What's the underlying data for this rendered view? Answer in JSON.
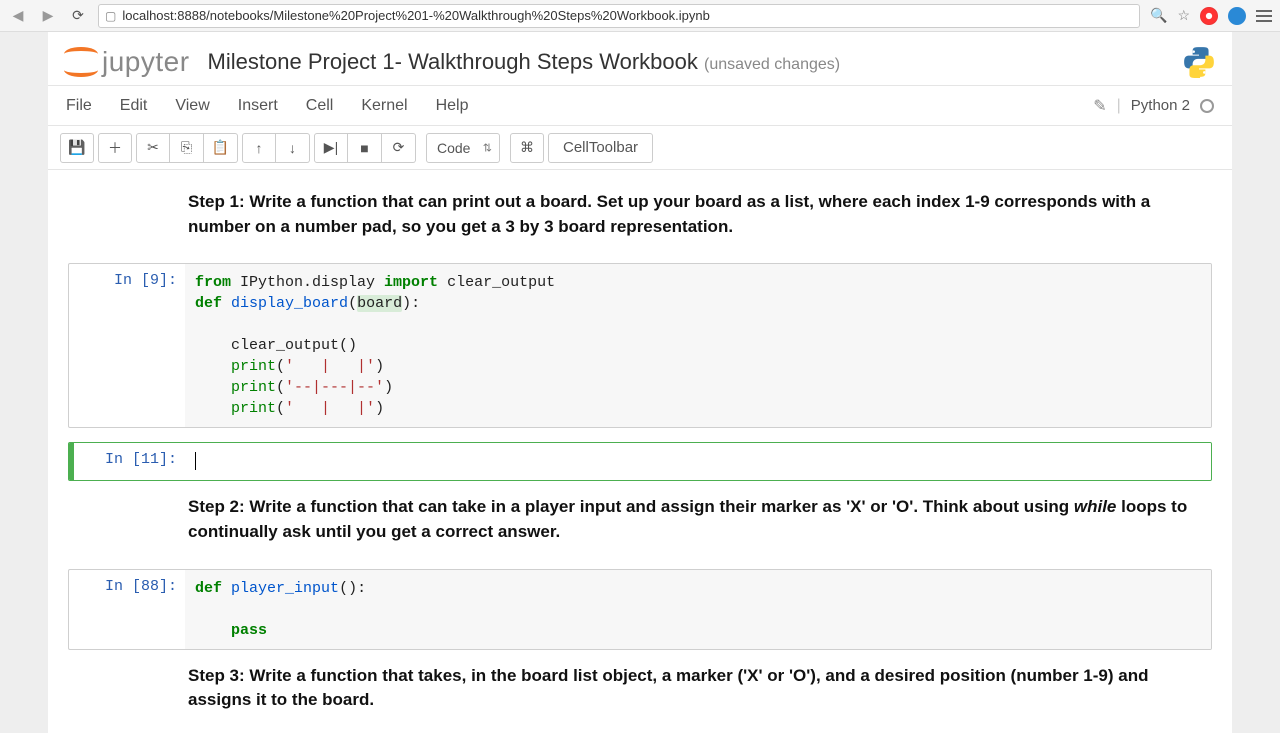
{
  "browser": {
    "url": "localhost:8888/notebooks/Milestone%20Project%201-%20Walkthrough%20Steps%20Workbook.ipynb"
  },
  "header": {
    "logo_text": "jupyter",
    "title": "Milestone Project 1- Walkthrough Steps Workbook",
    "status": "(unsaved changes)"
  },
  "menubar": {
    "items": [
      "File",
      "Edit",
      "View",
      "Insert",
      "Cell",
      "Kernel",
      "Help"
    ],
    "kernel": "Python 2"
  },
  "toolbar": {
    "cell_type": "Code",
    "celltoolbar": "CellToolbar"
  },
  "cells": {
    "step1_text": "Step 1: Write a function that can print out a board. Set up your board as a list, where each index 1-9 corresponds with a number on a number pad, so you get a 3 by 3 board representation.",
    "c1_prompt": "In [9]:",
    "c1_line1_a": "from",
    "c1_line1_b": " IPython.display ",
    "c1_line1_c": "import",
    "c1_line1_d": " clear_output",
    "c1_line2_a": "def",
    "c1_line2_b": " ",
    "c1_line2_c": "display_board",
    "c1_line2_d": "(",
    "c1_line2_e": "board",
    "c1_line2_f": "):",
    "c1_line3": "    ",
    "c1_line4": "    clear_output()",
    "c1_line5_a": "    ",
    "c1_line5_b": "print",
    "c1_line5_c": "(",
    "c1_line5_d": "'   |   |'",
    "c1_line5_e": ")",
    "c1_line6_a": "    ",
    "c1_line6_b": "print",
    "c1_line6_c": "(",
    "c1_line6_d": "'--|---|--'",
    "c1_line6_e": ")",
    "c1_line7_a": "    ",
    "c1_line7_b": "print",
    "c1_line7_c": "(",
    "c1_line7_d": "'   |   |'",
    "c1_line7_e": ")",
    "c2_prompt": "In [11]:",
    "step2_text_a": "Step 2: Write a function that can take in a player input and assign their marker as 'X' or 'O'. Think about using ",
    "step2_text_b": "while",
    "step2_text_c": " loops to continually ask until you get a correct answer.",
    "c3_prompt": "In [88]:",
    "c3_line1_a": "def",
    "c3_line1_b": " ",
    "c3_line1_c": "player_input",
    "c3_line1_d": "():",
    "c3_line2": "    ",
    "c3_line3": "    ",
    "c3_line3_b": "pass",
    "step3_text": "Step 3: Write a function that takes, in the board list object, a marker ('X' or 'O'), and a desired position (number 1-9) and assigns it to the board."
  }
}
